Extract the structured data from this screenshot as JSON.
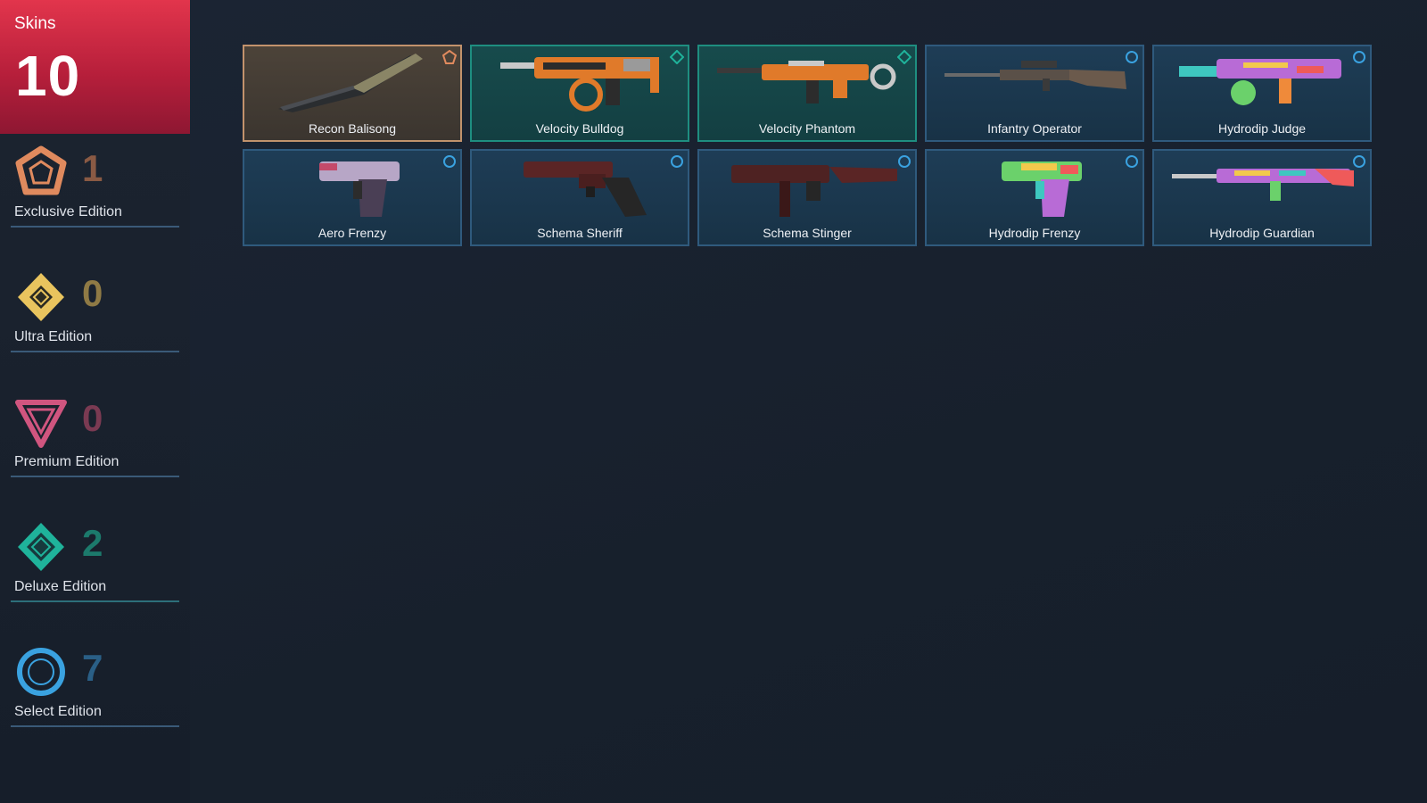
{
  "header": {
    "title": "Skins",
    "count": "10"
  },
  "tiers": [
    {
      "count": "1",
      "label": "Exclusive Edition",
      "color": "#e08a5e",
      "count_color": "#8a5a44",
      "line_color": "#3a5a78"
    },
    {
      "count": "0",
      "label": "Ultra Edition",
      "color": "#e9c45e",
      "count_color": "#8f7a45",
      "line_color": "#3a5a78"
    },
    {
      "count": "0",
      "label": "Premium Edition",
      "color": "#d0557f",
      "count_color": "#7a3a52",
      "line_color": "#3a5a78"
    },
    {
      "count": "2",
      "label": "Deluxe Edition",
      "color": "#1fb39b",
      "count_color": "#1c7a6c",
      "line_color": "#2d6f7a"
    },
    {
      "count": "7",
      "label": "Select Edition",
      "color": "#3aa2e0",
      "count_color": "#2a5f86",
      "line_color": "#3a5a78"
    }
  ],
  "skins": [
    {
      "name": "Recon Balisong",
      "tier": "exclusive",
      "weapon_icon": "knife-icon"
    },
    {
      "name": "Velocity Bulldog",
      "tier": "deluxe",
      "weapon_icon": "rifle-icon"
    },
    {
      "name": "Velocity Phantom",
      "tier": "deluxe",
      "weapon_icon": "rifle-icon"
    },
    {
      "name": "Infantry Operator",
      "tier": "select",
      "weapon_icon": "sniper-icon"
    },
    {
      "name": "Hydrodip Judge",
      "tier": "select",
      "weapon_icon": "shotgun-icon"
    },
    {
      "name": "Aero Frenzy",
      "tier": "select",
      "weapon_icon": "pistol-icon"
    },
    {
      "name": "Schema Sheriff",
      "tier": "select",
      "weapon_icon": "revolver-icon"
    },
    {
      "name": "Schema Stinger",
      "tier": "select",
      "weapon_icon": "smg-icon"
    },
    {
      "name": "Hydrodip Frenzy",
      "tier": "select",
      "weapon_icon": "pistol-icon"
    },
    {
      "name": "Hydrodip Guardian",
      "tier": "select",
      "weapon_icon": "rifle-icon"
    }
  ]
}
